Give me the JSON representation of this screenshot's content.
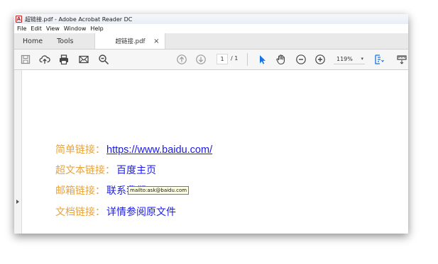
{
  "window": {
    "title": "超链接.pdf - Adobe Acrobat Reader DC"
  },
  "menu": [
    "File",
    "Edit",
    "View",
    "Window",
    "Help"
  ],
  "tabs": {
    "home": "Home",
    "tools": "Tools",
    "document": "超链接.pdf",
    "close": "×"
  },
  "toolbar": {
    "icons": [
      "save-icon",
      "upload-icon",
      "print-icon",
      "email-icon",
      "search-zoom-icon",
      "page-up-icon",
      "page-down-icon",
      "select-arrow-icon",
      "hand-icon",
      "zoom-out-icon",
      "zoom-in-icon",
      "fit-page-icon",
      "scroll-icon"
    ],
    "page_current": "1",
    "page_total": "/ 1",
    "zoom": "119%",
    "zoom_caret": "▾"
  },
  "document": {
    "rows": [
      {
        "label": "简单链接：",
        "link": "https://www.baidu.com/"
      },
      {
        "label": "超文本链接：",
        "link": "百度主页"
      },
      {
        "label": "邮箱链接：",
        "link": "联系我们"
      },
      {
        "label": "文档链接：",
        "link": "详情参阅原文件"
      }
    ],
    "tooltip": "mailto:ask@baidu.com"
  },
  "colors": {
    "label": "#e8a33a",
    "link": "#1a1aee",
    "accent_blue": "#1473e6"
  }
}
